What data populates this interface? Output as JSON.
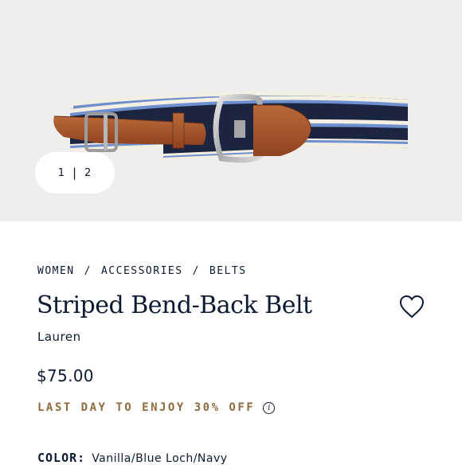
{
  "gallery": {
    "current_page": "1",
    "total_pages": "2"
  },
  "breadcrumb": {
    "items": [
      "WOMEN",
      "ACCESSORIES",
      "BELTS"
    ],
    "separator": "/"
  },
  "product": {
    "title": "Striped Bend-Back Belt",
    "brand": "Lauren",
    "price": "$75.00",
    "promo": "LAST DAY TO ENJOY 30% OFF",
    "color_label": "COLOR:",
    "color_value": "Vanilla/Blue Loch/Navy"
  },
  "icons": {
    "wishlist": "heart-icon",
    "promo_info": "info-icon"
  },
  "colors": {
    "hero_background": "#efeeed",
    "navy": "#0b1a33",
    "promo_gold": "#8e6a3f",
    "leather": "#a5532a",
    "stripe_blue": "#6f8fcf",
    "vanilla": "#f3efe3"
  }
}
